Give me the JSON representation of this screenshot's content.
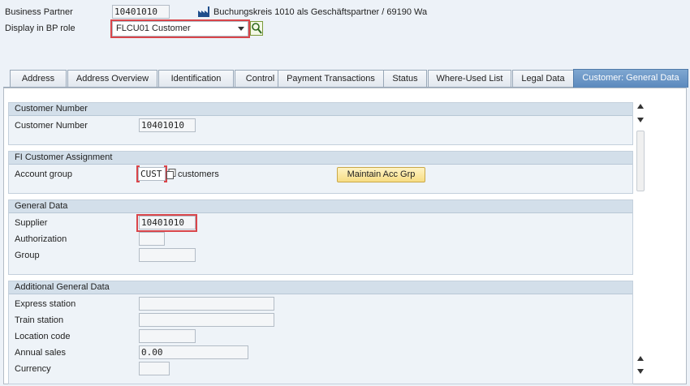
{
  "header": {
    "bp_label": "Business Partner",
    "bp_value": "10401010",
    "bp_description": "Buchungskreis 1010 als Geschäftspartner / 69190 Wa",
    "role_label": "Display in BP role",
    "role_value": "FLCU01 Customer"
  },
  "tabs": [
    {
      "label": "Address"
    },
    {
      "label": "Address Overview"
    },
    {
      "label": "Identification"
    },
    {
      "label": "Control"
    },
    {
      "label": "Payment Transactions"
    },
    {
      "label": "Status"
    },
    {
      "label": "Where-Used List"
    },
    {
      "label": "Legal Data"
    },
    {
      "label": "Customer: General Data"
    }
  ],
  "sections": {
    "customer_number": {
      "title": "Customer Number",
      "field_label": "Customer Number",
      "field_value": "10401010"
    },
    "fi_assignment": {
      "title": "FI Customer Assignment",
      "account_group_label": "Account group",
      "account_group_value": "CUST",
      "account_group_desc": "customers",
      "maintain_button": "Maintain Acc Grp"
    },
    "general_data": {
      "title": "General Data",
      "supplier_label": "Supplier",
      "supplier_value": "10401010",
      "authorization_label": "Authorization",
      "authorization_value": "",
      "group_label": "Group",
      "group_value": ""
    },
    "additional": {
      "title": "Additional General Data",
      "express_label": "Express station",
      "express_value": "",
      "train_label": "Train station",
      "train_value": "",
      "location_label": "Location code",
      "location_value": "",
      "sales_label": "Annual sales",
      "sales_value": "0.00",
      "currency_label": "Currency",
      "currency_value": ""
    }
  },
  "colors": {
    "highlight": "#d9454a",
    "active_tab": "#6a96c7",
    "button": "#f7dd84"
  }
}
